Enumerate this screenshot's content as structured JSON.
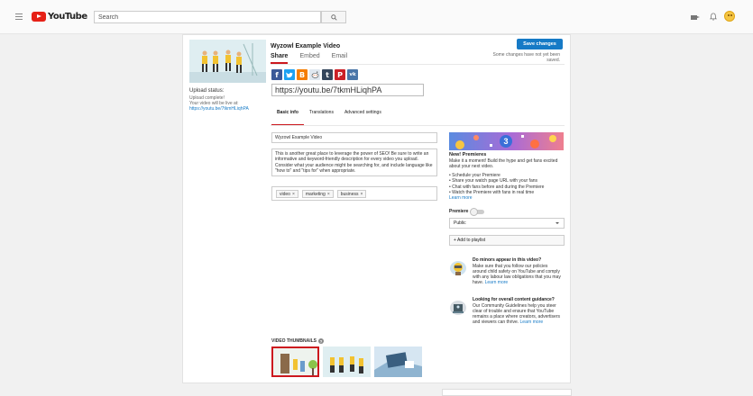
{
  "header": {
    "logo_text": "YouTube",
    "search_placeholder": "Search"
  },
  "video": {
    "title": "Wyzowl Example Video",
    "share_tabs": [
      "Share",
      "Embed",
      "Email"
    ],
    "save_label": "Save changes",
    "unsaved_note": "Some changes have not yet been saved.",
    "share_url": "https://youtu.be/7tkmHLiqhPA",
    "social": [
      {
        "glyph": "f",
        "color": "#3b5998"
      },
      {
        "glyph": "t",
        "color": "#1da1f2"
      },
      {
        "glyph": "B",
        "color": "#f57d00"
      },
      {
        "glyph": "r",
        "color": "#e0e8f0"
      },
      {
        "glyph": "t",
        "color": "#35465c"
      },
      {
        "glyph": "P",
        "color": "#cb2027"
      },
      {
        "glyph": "vk",
        "color": "#4a76a8"
      }
    ]
  },
  "upload": {
    "status_heading": "Upload status:",
    "status_text": "Upload complete!",
    "live_text": "Your video will be live at:",
    "live_link": "https://youtu.be/7tkmHLiqhPA"
  },
  "edit_tabs": [
    "Basic info",
    "Translations",
    "Advanced settings"
  ],
  "form": {
    "title_value": "Wyzowl Example Video",
    "description": "This is another great place to leverage the power of SEO! Be sure to write an informative and keyword-friendly description for every video you upload. Consider what your audience might be searching for, and include language like \"how to\" and \"tips for\" when appropriate.",
    "tags": [
      "video",
      "marketing",
      "business"
    ]
  },
  "premieres": {
    "heading": "New! Premieres",
    "intro": "Make it a moment! Build the hype and get fans excited about your next video.",
    "bullets": [
      "• Schedule your Premiere",
      "• Share your watch page URL with your fans",
      "• Chat with fans before and during the Premiere",
      "• Watch the Premiere with fans in real time"
    ],
    "learn_more": "Learn more",
    "toggle_label": "Premiere",
    "art_number": "3"
  },
  "visibility": {
    "selected": "Public"
  },
  "playlist_button": "+ Add to playlist",
  "tips": [
    {
      "title": "Do minors appear in this video?",
      "body": "Make sure that you follow our policies around child safety on YouTube and comply with any labour law obligations that you may have.",
      "link": "Learn more"
    },
    {
      "title": "Looking for overall content guidance?",
      "body": "Our Community Guidelines help you steer clear of trouble and ensure that YouTube remains a place where creators, advertisers and viewers can thrive.",
      "link": "Learn more"
    }
  ],
  "thumbnails": {
    "label": "VIDEO THUMBNAILS",
    "help": "?"
  },
  "colors": {
    "accent_red": "#cc181e",
    "link_blue": "#167ac6"
  }
}
